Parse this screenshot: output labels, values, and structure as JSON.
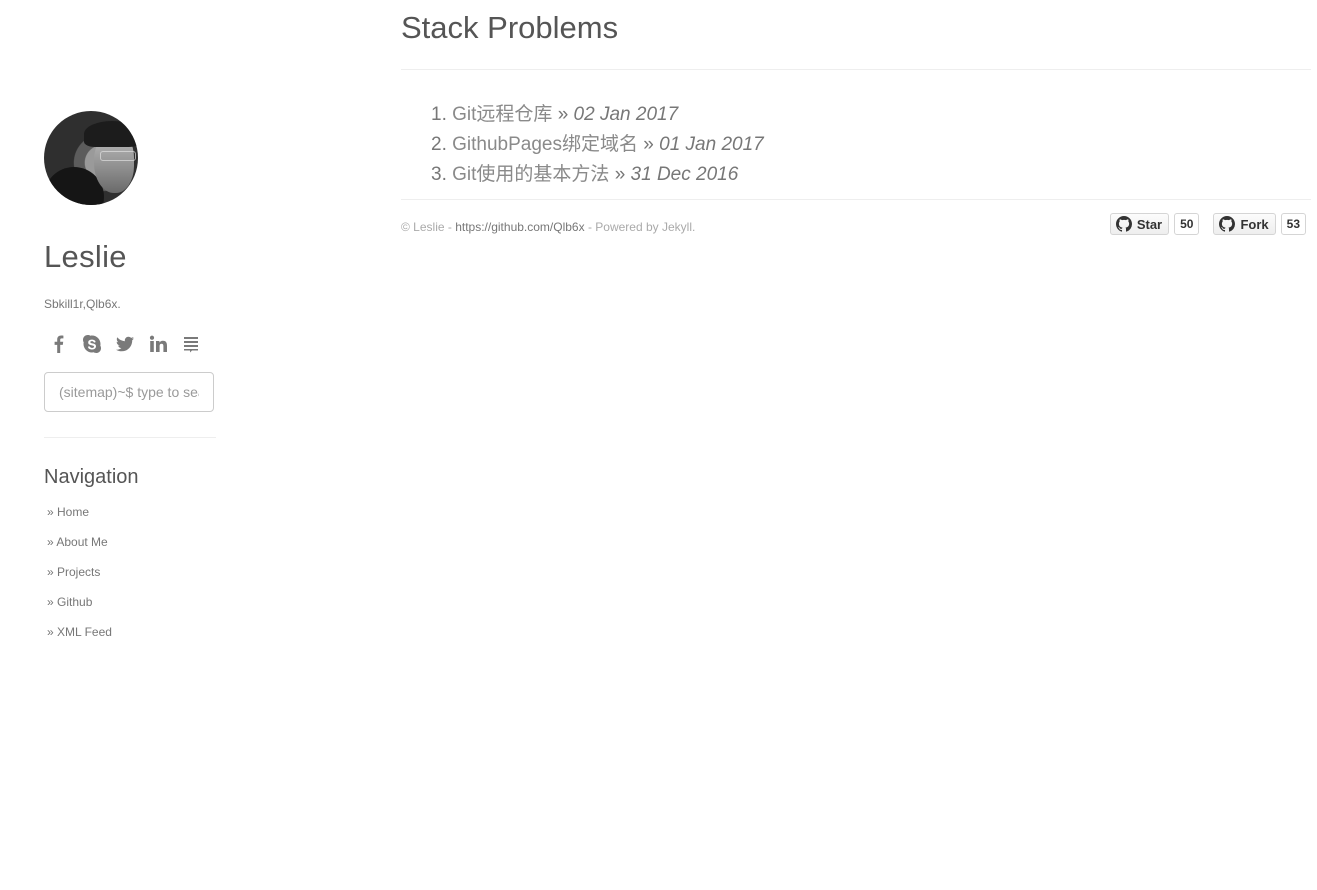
{
  "sidebar": {
    "name": "Leslie",
    "tagline": "Sbkill1r,Qlb6x.",
    "social": [
      {
        "icon": "facebook-icon"
      },
      {
        "icon": "skype-icon"
      },
      {
        "icon": "twitter-icon"
      },
      {
        "icon": "linkedin-icon"
      },
      {
        "icon": "stack-icon"
      }
    ],
    "search_placeholder": "(sitemap)~$ type to search",
    "nav_title": "Navigation",
    "nav": [
      {
        "label": "» Home"
      },
      {
        "label": "» About Me"
      },
      {
        "label": "» Projects"
      },
      {
        "label": "» Github"
      },
      {
        "label": "» XML Feed"
      }
    ]
  },
  "main": {
    "title": "Stack Problems",
    "posts": [
      {
        "num": "1.",
        "title": "Git远程仓库",
        "sep": " » ",
        "date": "02 Jan 2017"
      },
      {
        "num": "2.",
        "title": "GithubPages绑定域名",
        "sep": " » ",
        "date": "01 Jan 2017"
      },
      {
        "num": "3.",
        "title": "Git使用的基本方法",
        "sep": " » ",
        "date": "31 Dec 2016"
      }
    ]
  },
  "footer": {
    "prefix": "© Leslie - ",
    "link": "https://github.com/Qlb6x",
    "suffix": " - Powered by Jekyll.",
    "star_label": "Star",
    "star_count": "50",
    "fork_label": "Fork",
    "fork_count": "53"
  }
}
